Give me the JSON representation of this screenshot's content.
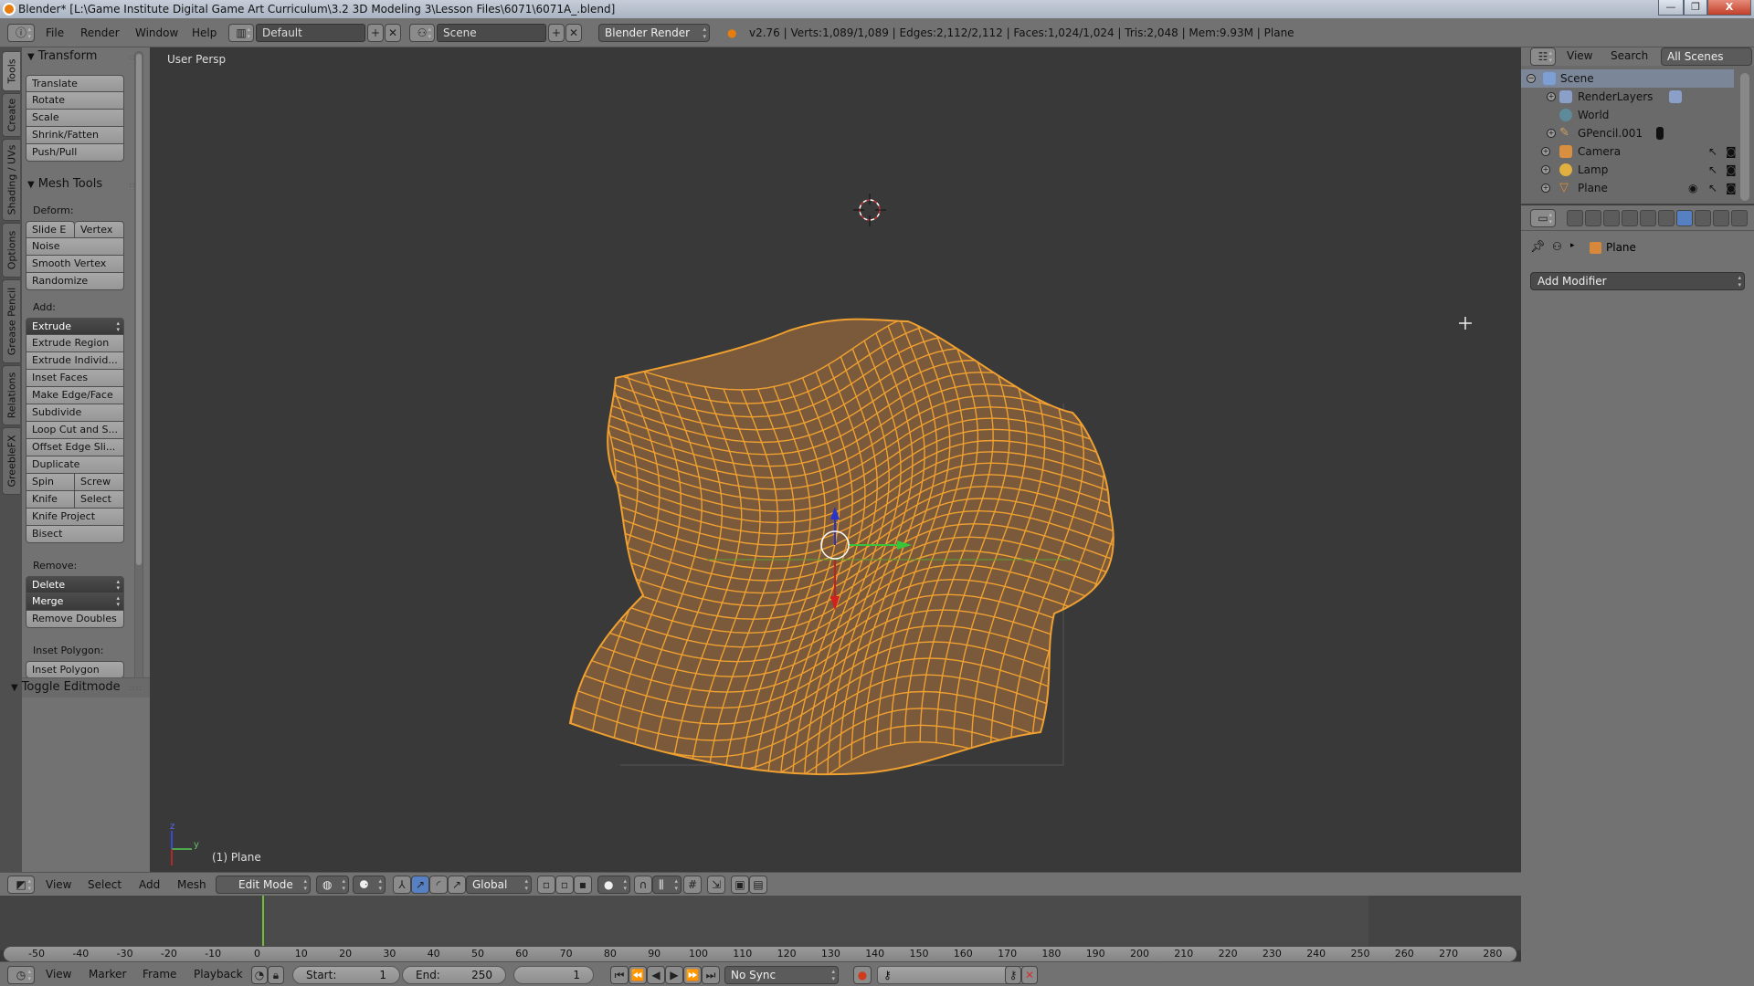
{
  "window": {
    "title": "Blender* [L:\\Game Institute Digital Game Art  Curriculum\\3.2 3D Modeling 3\\Lesson Files\\6071\\6071A_.blend]",
    "controls": {
      "minimize": "—",
      "maximize": "❐",
      "close": "X"
    }
  },
  "info_header": {
    "editor_icon": "info-icon",
    "menus": [
      "File",
      "Render",
      "Window",
      "Help"
    ],
    "layout": "Default",
    "scene": "Scene",
    "render_engine": "Blender Render",
    "stats": "v2.76 | Verts:1,089/1,089 | Edges:2,112/2,112 | Faces:1,024/1,024 | Tris:2,048 | Mem:9.93M | Plane"
  },
  "tool_tabs": [
    "Tools",
    "Create",
    "Shading / UVs",
    "Options",
    "Grease Pencil",
    "Relations",
    "GreebleFX"
  ],
  "tool_shelf": {
    "transform": {
      "title": "Transform",
      "buttons": [
        "Translate",
        "Rotate",
        "Scale",
        "Shrink/Fatten",
        "Push/Pull"
      ]
    },
    "mesh_tools": {
      "title": "Mesh Tools",
      "deform_label": "Deform:",
      "deform": {
        "slide_edge": "Slide E",
        "vertex": "Vertex",
        "noise": "Noise",
        "smooth_vertex": "Smooth Vertex",
        "randomize": "Randomize"
      },
      "add_label": "Add:",
      "add": {
        "extrude": "Extrude",
        "items": [
          "Extrude Region",
          "Extrude Individ...",
          "Inset Faces",
          "Make Edge/Face",
          "Subdivide",
          "Loop Cut and S...",
          "Offset Edge Sli...",
          "Duplicate"
        ],
        "spin": "Spin",
        "screw": "Screw",
        "knife": "Knife",
        "select": "Select",
        "knife_project": "Knife Project",
        "bisect": "Bisect"
      },
      "remove_label": "Remove:",
      "remove": {
        "delete": "Delete",
        "merge": "Merge",
        "remove_doubles": "Remove Doubles"
      },
      "inset_label": "Inset Polygon:",
      "inset_button": "Inset Polygon"
    },
    "toggle_editmode": "Toggle Editmode"
  },
  "viewport": {
    "view_label": "User Persp",
    "object_label": "(1) Plane",
    "axes": {
      "z": "z",
      "y": "y"
    },
    "colors": {
      "mesh_wire": "#f0a030",
      "mesh_face": "#7a5a3a",
      "background": "#393939"
    }
  },
  "viewport_header": {
    "menus": [
      "View",
      "Select",
      "Add",
      "Mesh"
    ],
    "mode": "Edit Mode",
    "orientation": "Global"
  },
  "timeline": {
    "ticks": [
      -50,
      -40,
      -30,
      -20,
      -10,
      0,
      10,
      20,
      30,
      40,
      50,
      60,
      70,
      80,
      90,
      100,
      110,
      120,
      130,
      140,
      150,
      160,
      170,
      180,
      190,
      200,
      210,
      220,
      230,
      240,
      250,
      260,
      270,
      280
    ],
    "current_frame": 1,
    "menus": [
      "View",
      "Marker",
      "Frame",
      "Playback"
    ],
    "start_label": "Start:",
    "start": "1",
    "end_label": "End:",
    "end": "250",
    "frame": "1",
    "sync": "No Sync"
  },
  "outliner": {
    "menus": [
      "View",
      "Search"
    ],
    "filter": "All Scenes",
    "items": [
      {
        "name": "Scene",
        "icon": "scene-icon",
        "depth": 0
      },
      {
        "name": "RenderLayers",
        "icon": "renderlayers-icon",
        "depth": 1
      },
      {
        "name": "World",
        "icon": "world-icon",
        "depth": 1
      },
      {
        "name": "GPencil.001",
        "icon": "grease-pencil-icon",
        "depth": 1
      },
      {
        "name": "Camera",
        "icon": "camera-icon",
        "depth": 1
      },
      {
        "name": "Lamp",
        "icon": "lamp-icon",
        "depth": 1
      },
      {
        "name": "Plane",
        "icon": "mesh-icon",
        "depth": 1
      }
    ]
  },
  "properties": {
    "breadcrumb_object": "Plane",
    "add_modifier": "Add Modifier",
    "active_tab": "modifiers"
  }
}
